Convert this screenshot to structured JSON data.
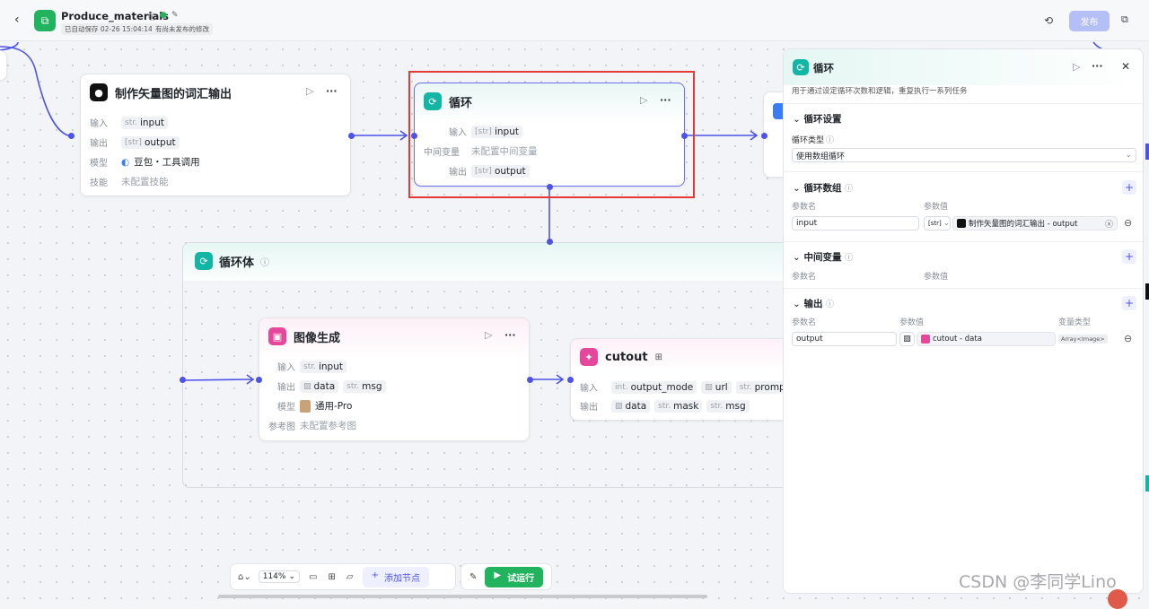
{
  "topbar": {
    "app_title": "Produce_materials",
    "autosave": "已自动保存 02-26 15:04:14",
    "unpublished": "有尚未发布的修改",
    "publish_label": "发布"
  },
  "nodes": {
    "vector_node": {
      "title": "制作矢量图的词汇输出",
      "input_label": "输入",
      "input_type": "str.",
      "input_value": "input",
      "output_label": "输出",
      "output_type": "[str]",
      "output_value": "output",
      "model_label": "模型",
      "model_value": "豆包・工具调用",
      "skill_label": "技能",
      "skill_value": "未配置技能"
    },
    "loop_node": {
      "title": "循环",
      "input_label": "输入",
      "input_type": "[str]",
      "input_value": "input",
      "mid_label": "中间变量",
      "mid_value": "未配置中间变量",
      "output_label": "输出",
      "output_type": "[str]",
      "output_value": "output"
    },
    "loop_body": {
      "title": "循环体"
    },
    "image_node": {
      "title": "图像生成",
      "input_label": "输入",
      "input_type": "str.",
      "input_value": "input",
      "output_label": "输出",
      "output_value1": "data",
      "output_type2": "str.",
      "output_value2": "msg",
      "model_label": "模型",
      "model_value": "通用-Pro",
      "ref_label": "参考图",
      "ref_value": "未配置参考图"
    },
    "cutout_node": {
      "title": "cutout",
      "input_label": "输入",
      "in_type1": "int.",
      "in1": "output_mode",
      "in2": "url",
      "in_type3": "str.",
      "in3": "prompt",
      "output_label": "输出",
      "out1": "data",
      "out_type2": "str.",
      "out2": "mask",
      "out_type3": "str.",
      "out3": "msg"
    }
  },
  "panel": {
    "title": "循环",
    "description": "用于通过设定循环次数和逻辑，重复执行一系列任务",
    "loop_settings": "循环设置",
    "loop_type_label": "循环类型",
    "loop_type_value": "使用数组循环",
    "loop_array": "循环数组",
    "param_name": "参数名",
    "param_value": "参数值",
    "array_input_name": "input",
    "array_type": "[str]",
    "array_ref": "制作矢量图的词汇输出 - output",
    "mid_vars": "中间变量",
    "output_section": "输出",
    "var_type": "变量类型",
    "output_name": "output",
    "output_ref": "cutout - data",
    "output_type": "Array<Image>"
  },
  "bottombar": {
    "zoom": "114%",
    "add_node": "添加节点",
    "test_run": "试运行"
  },
  "watermark": "CSDN @李同学Lino",
  "colors": {
    "accent": "#4d53e8",
    "loop": "#13b5a4",
    "run": "#22b35e",
    "highlight": "#e53935"
  }
}
